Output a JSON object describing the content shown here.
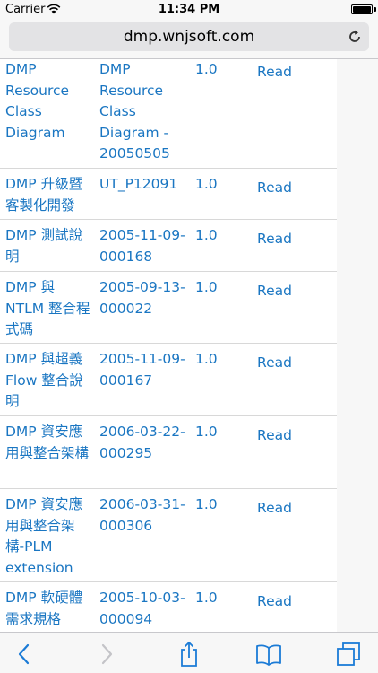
{
  "status_bar": {
    "carrier": "Carrier",
    "time": "11:34 PM"
  },
  "browser": {
    "url": "dmp.wnjsoft.com"
  },
  "rows": [
    {
      "name": "DMP Resource Class Diagram",
      "code": "DMP Resource Class Diagram - 20050505",
      "version": "1.0",
      "action": "Read"
    },
    {
      "name": "DMP 升級暨客製化開發",
      "code": "UT_P12091",
      "version": "1.0",
      "action": "Read"
    },
    {
      "name": "DMP 測試說明",
      "code": "2005-11-09-000168",
      "version": "1.0",
      "action": "Read"
    },
    {
      "name": "DMP 與 NTLM 整合程式碼",
      "code": "2005-09-13-000022",
      "version": "1.0",
      "action": "Read"
    },
    {
      "name": "DMP 與超義 Flow 整合說明",
      "code": "2005-11-09-000167",
      "version": "1.0",
      "action": "Read"
    },
    {
      "name": "DMP 資安應用與整合架構",
      "code": "2006-03-22-000295",
      "version": "1.0",
      "action": "Read"
    },
    {
      "name": "DMP 資安應用與整合架構-PLM extension",
      "code": "2006-03-31-000306",
      "version": "1.0",
      "action": "Read"
    },
    {
      "name": "DMP 軟硬體需求規格",
      "code": "2005-10-03-000094",
      "version": "1.0",
      "action": "Read"
    }
  ],
  "colors": {
    "link": "#1a76c2",
    "toolbar_icon": "#1b7bd6",
    "toolbar_icon_disabled": "#c4c4c8"
  },
  "toolbar": {
    "icons": [
      "back-icon",
      "forward-icon",
      "share-icon",
      "bookmarks-icon",
      "tabs-icon"
    ]
  }
}
